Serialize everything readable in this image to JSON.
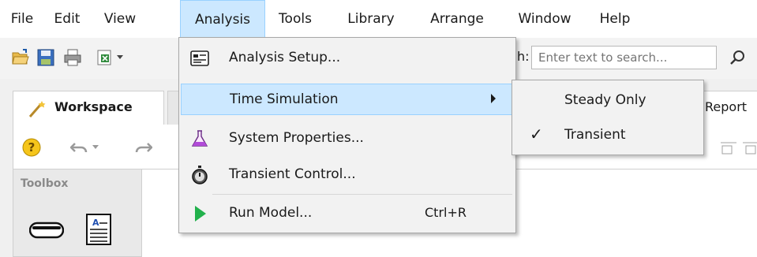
{
  "menubar": {
    "items": [
      {
        "label": "File"
      },
      {
        "label": "Edit"
      },
      {
        "label": "View"
      },
      {
        "label": "Analysis"
      },
      {
        "label": "Tools"
      },
      {
        "label": "Library"
      },
      {
        "label": "Arrange"
      },
      {
        "label": "Window"
      },
      {
        "label": "Help"
      }
    ]
  },
  "toolbar": {
    "search_label": "h:",
    "search_placeholder": "Enter text to search..."
  },
  "tabs": {
    "workspace": "Workspace",
    "report": "Report"
  },
  "toolbox": {
    "title": "Toolbox"
  },
  "analysis_menu": {
    "items": [
      {
        "label": "Analysis Setup...",
        "icon": "analysis-setup-icon"
      },
      {
        "label": "Time Simulation",
        "icon": "",
        "has_submenu": true
      },
      {
        "label": "System Properties...",
        "icon": "flask-icon"
      },
      {
        "label": "Transient Control...",
        "icon": "stopwatch-icon"
      },
      {
        "label": "Run Model...",
        "icon": "run-icon",
        "shortcut": "Ctrl+R"
      }
    ]
  },
  "time_simulation_submenu": {
    "items": [
      {
        "label": "Steady Only",
        "checked": false
      },
      {
        "label": "Transient",
        "checked": true,
        "check_mark": "✓"
      }
    ]
  },
  "colors": {
    "highlight": "#cce8ff",
    "highlight_border": "#99d1ff",
    "run_green": "#22b14c",
    "flask_purple": "#b24bd9"
  }
}
